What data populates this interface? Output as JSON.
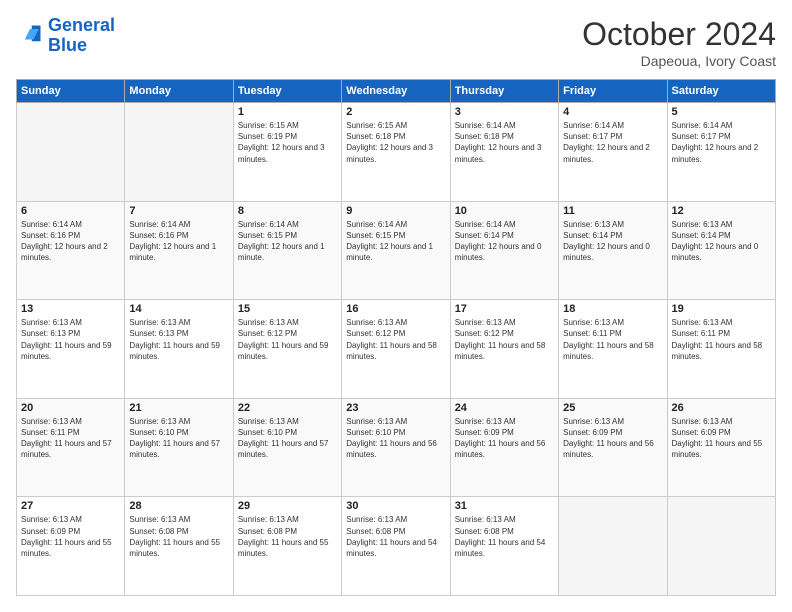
{
  "header": {
    "logo_line1": "General",
    "logo_line2": "Blue",
    "month": "October 2024",
    "location": "Dapeoua, Ivory Coast"
  },
  "days_of_week": [
    "Sunday",
    "Monday",
    "Tuesday",
    "Wednesday",
    "Thursday",
    "Friday",
    "Saturday"
  ],
  "weeks": [
    [
      {
        "day": "",
        "empty": true
      },
      {
        "day": "",
        "empty": true
      },
      {
        "day": "1",
        "sunrise": "Sunrise: 6:15 AM",
        "sunset": "Sunset: 6:19 PM",
        "daylight": "Daylight: 12 hours and 3 minutes."
      },
      {
        "day": "2",
        "sunrise": "Sunrise: 6:15 AM",
        "sunset": "Sunset: 6:18 PM",
        "daylight": "Daylight: 12 hours and 3 minutes."
      },
      {
        "day": "3",
        "sunrise": "Sunrise: 6:14 AM",
        "sunset": "Sunset: 6:18 PM",
        "daylight": "Daylight: 12 hours and 3 minutes."
      },
      {
        "day": "4",
        "sunrise": "Sunrise: 6:14 AM",
        "sunset": "Sunset: 6:17 PM",
        "daylight": "Daylight: 12 hours and 2 minutes."
      },
      {
        "day": "5",
        "sunrise": "Sunrise: 6:14 AM",
        "sunset": "Sunset: 6:17 PM",
        "daylight": "Daylight: 12 hours and 2 minutes."
      }
    ],
    [
      {
        "day": "6",
        "sunrise": "Sunrise: 6:14 AM",
        "sunset": "Sunset: 6:16 PM",
        "daylight": "Daylight: 12 hours and 2 minutes."
      },
      {
        "day": "7",
        "sunrise": "Sunrise: 6:14 AM",
        "sunset": "Sunset: 6:16 PM",
        "daylight": "Daylight: 12 hours and 1 minute."
      },
      {
        "day": "8",
        "sunrise": "Sunrise: 6:14 AM",
        "sunset": "Sunset: 6:15 PM",
        "daylight": "Daylight: 12 hours and 1 minute."
      },
      {
        "day": "9",
        "sunrise": "Sunrise: 6:14 AM",
        "sunset": "Sunset: 6:15 PM",
        "daylight": "Daylight: 12 hours and 1 minute."
      },
      {
        "day": "10",
        "sunrise": "Sunrise: 6:14 AM",
        "sunset": "Sunset: 6:14 PM",
        "daylight": "Daylight: 12 hours and 0 minutes."
      },
      {
        "day": "11",
        "sunrise": "Sunrise: 6:13 AM",
        "sunset": "Sunset: 6:14 PM",
        "daylight": "Daylight: 12 hours and 0 minutes."
      },
      {
        "day": "12",
        "sunrise": "Sunrise: 6:13 AM",
        "sunset": "Sunset: 6:14 PM",
        "daylight": "Daylight: 12 hours and 0 minutes."
      }
    ],
    [
      {
        "day": "13",
        "sunrise": "Sunrise: 6:13 AM",
        "sunset": "Sunset: 6:13 PM",
        "daylight": "Daylight: 11 hours and 59 minutes."
      },
      {
        "day": "14",
        "sunrise": "Sunrise: 6:13 AM",
        "sunset": "Sunset: 6:13 PM",
        "daylight": "Daylight: 11 hours and 59 minutes."
      },
      {
        "day": "15",
        "sunrise": "Sunrise: 6:13 AM",
        "sunset": "Sunset: 6:12 PM",
        "daylight": "Daylight: 11 hours and 59 minutes."
      },
      {
        "day": "16",
        "sunrise": "Sunrise: 6:13 AM",
        "sunset": "Sunset: 6:12 PM",
        "daylight": "Daylight: 11 hours and 58 minutes."
      },
      {
        "day": "17",
        "sunrise": "Sunrise: 6:13 AM",
        "sunset": "Sunset: 6:12 PM",
        "daylight": "Daylight: 11 hours and 58 minutes."
      },
      {
        "day": "18",
        "sunrise": "Sunrise: 6:13 AM",
        "sunset": "Sunset: 6:11 PM",
        "daylight": "Daylight: 11 hours and 58 minutes."
      },
      {
        "day": "19",
        "sunrise": "Sunrise: 6:13 AM",
        "sunset": "Sunset: 6:11 PM",
        "daylight": "Daylight: 11 hours and 58 minutes."
      }
    ],
    [
      {
        "day": "20",
        "sunrise": "Sunrise: 6:13 AM",
        "sunset": "Sunset: 6:11 PM",
        "daylight": "Daylight: 11 hours and 57 minutes."
      },
      {
        "day": "21",
        "sunrise": "Sunrise: 6:13 AM",
        "sunset": "Sunset: 6:10 PM",
        "daylight": "Daylight: 11 hours and 57 minutes."
      },
      {
        "day": "22",
        "sunrise": "Sunrise: 6:13 AM",
        "sunset": "Sunset: 6:10 PM",
        "daylight": "Daylight: 11 hours and 57 minutes."
      },
      {
        "day": "23",
        "sunrise": "Sunrise: 6:13 AM",
        "sunset": "Sunset: 6:10 PM",
        "daylight": "Daylight: 11 hours and 56 minutes."
      },
      {
        "day": "24",
        "sunrise": "Sunrise: 6:13 AM",
        "sunset": "Sunset: 6:09 PM",
        "daylight": "Daylight: 11 hours and 56 minutes."
      },
      {
        "day": "25",
        "sunrise": "Sunrise: 6:13 AM",
        "sunset": "Sunset: 6:09 PM",
        "daylight": "Daylight: 11 hours and 56 minutes."
      },
      {
        "day": "26",
        "sunrise": "Sunrise: 6:13 AM",
        "sunset": "Sunset: 6:09 PM",
        "daylight": "Daylight: 11 hours and 55 minutes."
      }
    ],
    [
      {
        "day": "27",
        "sunrise": "Sunrise: 6:13 AM",
        "sunset": "Sunset: 6:09 PM",
        "daylight": "Daylight: 11 hours and 55 minutes."
      },
      {
        "day": "28",
        "sunrise": "Sunrise: 6:13 AM",
        "sunset": "Sunset: 6:08 PM",
        "daylight": "Daylight: 11 hours and 55 minutes."
      },
      {
        "day": "29",
        "sunrise": "Sunrise: 6:13 AM",
        "sunset": "Sunset: 6:08 PM",
        "daylight": "Daylight: 11 hours and 55 minutes."
      },
      {
        "day": "30",
        "sunrise": "Sunrise: 6:13 AM",
        "sunset": "Sunset: 6:08 PM",
        "daylight": "Daylight: 11 hours and 54 minutes."
      },
      {
        "day": "31",
        "sunrise": "Sunrise: 6:13 AM",
        "sunset": "Sunset: 6:08 PM",
        "daylight": "Daylight: 11 hours and 54 minutes."
      },
      {
        "day": "",
        "empty": true
      },
      {
        "day": "",
        "empty": true
      }
    ]
  ]
}
